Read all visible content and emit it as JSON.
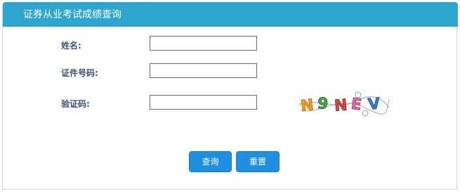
{
  "header": {
    "title": "证券从业考试成绩查询"
  },
  "form": {
    "name_label": "姓名:",
    "name_value": "",
    "id_label": "证件号码:",
    "id_value": "",
    "captcha_label": "验证码:",
    "captcha_value": "",
    "captcha_text": "N9NEV"
  },
  "buttons": {
    "query_label": "查询",
    "reset_label": "重置"
  },
  "colors": {
    "header_bg": "#2da7cf",
    "label_text": "#3a5573",
    "button_bg": "#1e8fe0"
  }
}
